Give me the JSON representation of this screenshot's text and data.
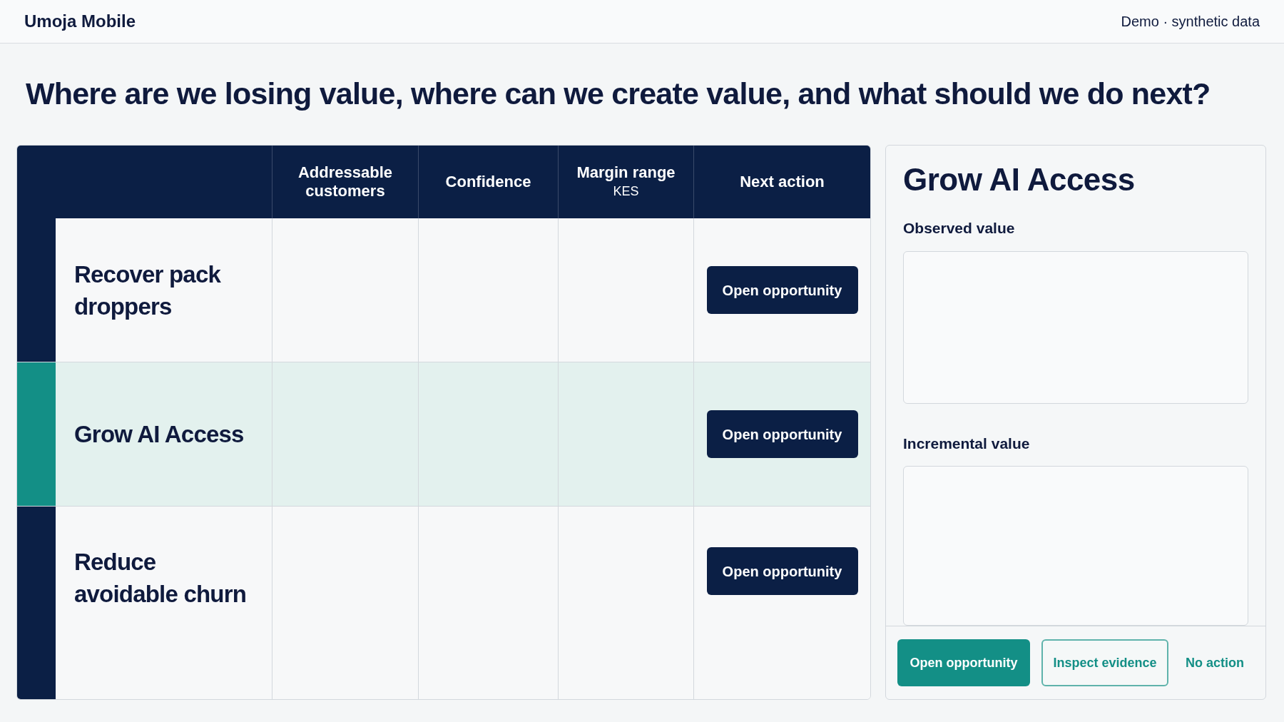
{
  "header": {
    "brand": "Umoja Mobile",
    "note": "Demo · synthetic data"
  },
  "headline": "Where are we losing value, where can we create value, and what should we do next?",
  "table": {
    "columns": [
      {
        "label": "Addressable customers"
      },
      {
        "label": "Confidence"
      },
      {
        "label": "Margin range",
        "sublabel": "KES"
      },
      {
        "label": "Next action"
      }
    ],
    "rows": [
      {
        "label": "Recover pack droppers",
        "selected": false,
        "action": "Open opportunity"
      },
      {
        "label": "Grow AI Access",
        "selected": true,
        "action": "Open opportunity"
      },
      {
        "label": "Reduce avoidable churn",
        "selected": false,
        "action": "Open opportunity"
      }
    ]
  },
  "detail": {
    "title": "Grow AI Access",
    "sections": [
      {
        "label": "Observed value"
      },
      {
        "label": "Incremental value"
      }
    ],
    "buttons": [
      {
        "label": "Open opportunity",
        "kind": "primary"
      },
      {
        "label": "Inspect evidence",
        "kind": "outline"
      },
      {
        "label": "No action",
        "kind": "link"
      }
    ]
  }
}
